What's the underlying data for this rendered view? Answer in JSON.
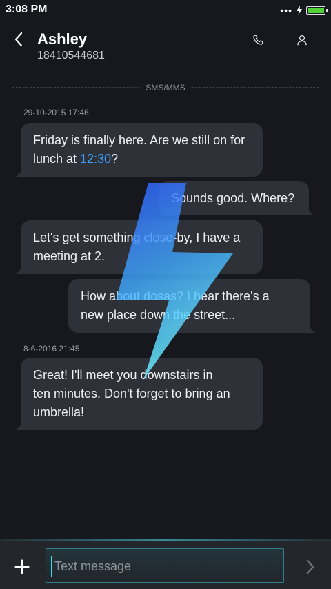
{
  "status_bar": {
    "time": "3:08 PM",
    "signal_dots": "•••",
    "battery_color": "#55d13a"
  },
  "header": {
    "contact_name": "Ashley",
    "contact_number": "18410544681",
    "back_icon": "chevron-left-icon",
    "call_icon": "phone-icon",
    "profile_icon": "person-icon"
  },
  "conversation": {
    "channel_label": "SMS/MMS",
    "groups": [
      {
        "timestamp": "29-10-2015 17:46",
        "messages": [
          {
            "direction": "incoming",
            "line1": "Friday is finally here. Are we still on for",
            "line2_before": "lunch at ",
            "line2_link": "12:30",
            "line2_after": "?"
          },
          {
            "direction": "outgoing",
            "text": "Sounds good. Where?"
          },
          {
            "direction": "incoming",
            "line1": "Let's get something close-by, I have a",
            "line2": "meeting at 2."
          },
          {
            "direction": "outgoing",
            "line1": "How about dosas? I hear there's a",
            "line2": "new place down the street..."
          }
        ]
      },
      {
        "timestamp": "8-6-2016 21:45",
        "messages": [
          {
            "direction": "incoming",
            "line1": "Great! I'll meet you downstairs in",
            "line2": "ten minutes. Don't forget to bring an",
            "line3": "umbrella!"
          }
        ]
      }
    ]
  },
  "composer": {
    "placeholder": "Text message",
    "add_icon": "plus-icon",
    "send_icon": "chevron-right-icon",
    "accent_color": "#46d6e8"
  },
  "decoration": {
    "bolt_icon": "lightning-bolt-icon"
  }
}
